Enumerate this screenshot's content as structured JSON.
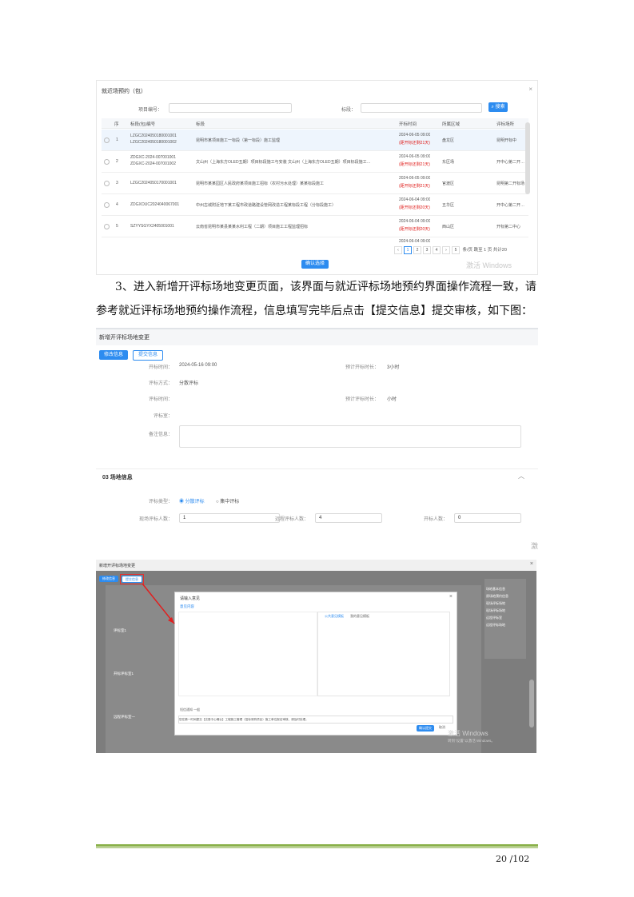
{
  "shot1": {
    "title": "就近场预约（包）",
    "close": "×",
    "search_label": "项目编号：",
    "search_placeholder": "标段：",
    "search_button": "搜索",
    "headers": [
      "序",
      "标段(包)编号",
      "标段",
      "开标时间",
      "所属区域",
      "评标场所"
    ],
    "rows": [
      {
        "n": "1",
        "code": "LZGC2024050180001001\nLZGC2024050180001002",
        "name": "昆明市某项目施工一标段（第一标段）施工监理",
        "time": "2024-06-05 09:00",
        "note": "(距开标还剩21天)",
        "area": "盘龙区",
        "place": "昆明开标中"
      },
      {
        "n": "2",
        "code": "ZDGXC-2024-007001001\nZDGXC-2024-007001002",
        "name": "文山州（上海东方OLED五期）项目标段施工与安装 文山州（上海东方OLED五期）项目标段施工…",
        "time": "2024-06-05 09:00",
        "note": "(距开标还剩21天)",
        "area": "东区场",
        "place": "开中心第二开…"
      },
      {
        "n": "3",
        "code": "LZGC2024050170001001",
        "name": "昆明市某某园区人民政府某项目施工招标（农村污水处理）某某标段施工",
        "time": "2024-06-05 09:00",
        "note": "(距开标还剩21天)",
        "area": "官渡区",
        "place": "昆明第二开标场"
      },
      {
        "n": "4",
        "code": "ZDGXOUC2024040067001",
        "name": "中州古城附近地下某工程市政道路建设管网改造工程某标段工程（分标段施工）",
        "time": "2024-06-04 09:00",
        "note": "(距开标还剩20天)",
        "area": "五华区",
        "place": "开中心第二开…"
      },
      {
        "n": "5",
        "code": "SZYYSGYX2405001001",
        "name": "云南省昆明市某县某某水利工程（二期）项目施工工程监理招标",
        "time": "2024-06-04 09:00",
        "note": "(距开标还剩20天)",
        "area": "西山区",
        "place": "开标第二中心"
      }
    ],
    "partial_time": "2024-06-04 09:00",
    "pages": [
      "1",
      "2",
      "3",
      "4",
      "5"
    ],
    "page_size": "条/页",
    "goto_label": "跳至",
    "goto_page": "1",
    "total": "页 共计20",
    "confirm_button": "确认选择",
    "watermark": "激活 Windows"
  },
  "paragraph": {
    "line1": "3、进入新增开评标场地变更页面，该界面与就近评标场地预约界面操作流程一致，请",
    "line2": "参考就近评标场地预约操作流程，信息填写完毕后点击【提交信息】提交审核，如下图："
  },
  "shot2": {
    "title": "新增开评标场地变更",
    "btn_modify": "修改信息",
    "btn_submit": "提交信息",
    "open_time_label": "开标时间：",
    "open_time": "2024-05-16 09:00",
    "expect_label": "预计开标时长：",
    "expect_val": "3小时",
    "method_label": "评标方式：",
    "method_val": "分散评标",
    "eval_time_label": "评标时间：",
    "eval_dur_label": "预计评标时长：",
    "eval_dur_val": "小时",
    "room_label": "评标室：",
    "notes_label": "备注信息：",
    "section": "03  场地信息",
    "eval_type_label": "评标类型：",
    "opt1": "分散评标",
    "opt2": "集中评标",
    "count1_label": "现场评标人数：",
    "count1": "1",
    "count2_label": "远程评标人数：",
    "count2": "4",
    "count3_label": "开标人数：",
    "count3": "0",
    "side_watermark": "激"
  },
  "shot3": {
    "title": "新增开评标场地变更",
    "btn_a": "修改信息",
    "btn_b": "提交信息",
    "dialog_title": "请输入意见",
    "dialog_close": "×",
    "tab_active": "意见内容",
    "tab1": "公共意见模板",
    "tab2": "我的意见模板",
    "rows": [
      "评标室1",
      "开标评标室1",
      "远程评标室一"
    ],
    "sidebar": [
      "场地基本信息",
      "原场地预约信息",
      "现场评标场地",
      "现场评标场地",
      "远程评标室",
      "远程评标场地"
    ],
    "footer_text": "您在第一时间提交【交易中心确认】工程施工管理（招标采购项目）施工单位报名审核、请及时处理。",
    "confirm": "确认提交",
    "cancel": "取消",
    "select_label": "短信通知",
    "select_val": "一般",
    "watermark1": "激活 Windows",
    "watermark2": "转到\"设置\"以激活 Windows。"
  },
  "page_number": "20 /102"
}
